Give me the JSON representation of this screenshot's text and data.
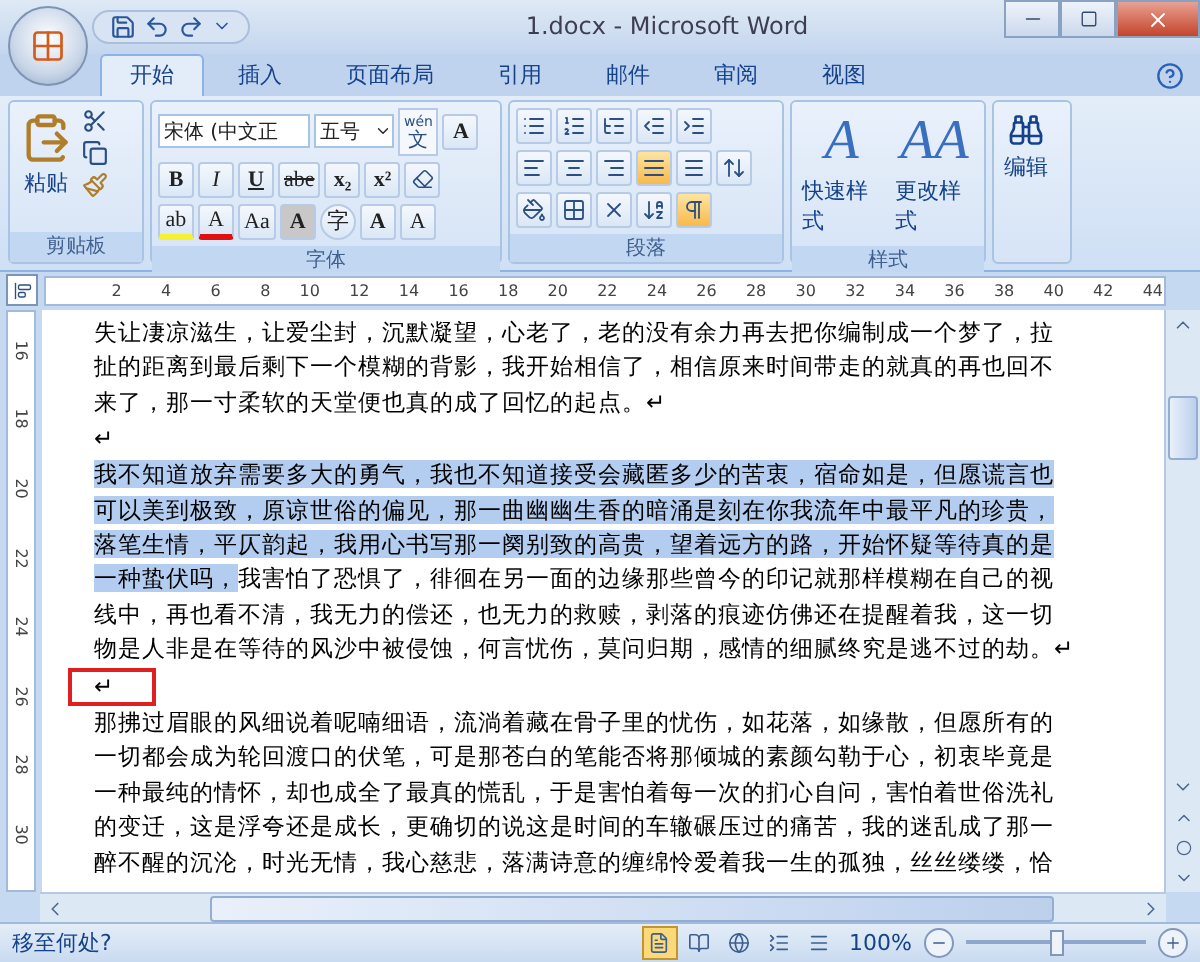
{
  "window": {
    "title": "1.docx - Microsoft Word"
  },
  "tabs": [
    {
      "label": "开始",
      "selected": true
    },
    {
      "label": "插入",
      "selected": false
    },
    {
      "label": "页面布局",
      "selected": false
    },
    {
      "label": "引用",
      "selected": false
    },
    {
      "label": "邮件",
      "selected": false
    },
    {
      "label": "审阅",
      "selected": false
    },
    {
      "label": "视图",
      "selected": false
    }
  ],
  "clipboard": {
    "label": "剪贴板",
    "paste": "粘贴"
  },
  "font": {
    "label": "字体",
    "font_name": "宋体 (中文正",
    "font_size": "五号",
    "phonetic": {
      "pinyin": "wén",
      "char": "文"
    },
    "border_char": "A",
    "row2": [
      {
        "text": "B",
        "kind": "bold"
      },
      {
        "text": "I",
        "kind": "italic"
      },
      {
        "text": "U",
        "kind": "underline"
      },
      {
        "text": "abe",
        "kind": "strike"
      },
      {
        "text": "x₂",
        "kind": "plain"
      },
      {
        "text": "x²",
        "kind": "plain"
      }
    ],
    "row3": [
      {
        "text": "ab",
        "kind": "highlight"
      },
      {
        "text": "A",
        "kind": "color"
      },
      {
        "text": "Aa",
        "kind": "plain"
      },
      {
        "text": "A",
        "kind": "shaded"
      },
      {
        "text": "字",
        "kind": "circled"
      },
      {
        "text": "A",
        "kind": "grow"
      },
      {
        "text": "A",
        "kind": "shrink"
      }
    ]
  },
  "paragraph": {
    "label": "段落",
    "alignment": [
      {
        "selected": false
      },
      {
        "selected": false
      },
      {
        "selected": false
      },
      {
        "selected": true
      },
      {
        "selected": false
      }
    ],
    "show_marks": true
  },
  "styles": {
    "label": "样式",
    "buttons": [
      {
        "glyph": "A",
        "label": "快速样式"
      },
      {
        "glyph": "AA",
        "label": "更改样式"
      }
    ]
  },
  "editing": {
    "label": "编辑"
  },
  "ruler": {
    "ticks": [
      "2",
      "4",
      "6",
      "8",
      "10",
      "12",
      "14",
      "16",
      "18",
      "20",
      "22",
      "24",
      "26",
      "28",
      "30",
      "32",
      "34",
      "36",
      "38",
      "40",
      "42",
      "44"
    ],
    "vertical_ticks": [
      "16",
      "18",
      "20",
      "22",
      "24",
      "26",
      "28",
      "30"
    ]
  },
  "document": {
    "paragraphs": [
      {
        "marked": false,
        "lines": [
          [
            {
              "text": "失让凄凉滋生，让爱尘封，沉默凝望，心老了，老的没有余力再去把你编制成一个梦了，拉",
              "selected": false
            }
          ],
          [
            {
              "text": "扯的距离到最后剩下一个模糊的背影，我开始相信了，相信原来时间带走的就真的再也回不",
              "selected": false
            }
          ],
          [
            {
              "text": "来了，那一寸柔软的天堂便也真的成了回忆的起点。↵",
              "selected": false
            }
          ]
        ]
      },
      {
        "marked": false,
        "lines": [
          [
            {
              "text": "↵",
              "selected": false
            }
          ]
        ]
      },
      {
        "marked": false,
        "lines": [
          [
            {
              "text": "我不知道放弃需要多大的勇气，我也不知道接受会藏匿多少的苦衷，宿命如是，但愿谎言也",
              "selected": true
            }
          ],
          [
            {
              "text": "可以美到极致，原谅世俗的偏见，那一曲幽幽生香的暗涌是刻在你我流年中最平凡的珍贵，",
              "selected": true
            }
          ],
          [
            {
              "text": "落笔生情，平仄韵起，我用心书写那一阕别致的高贵，望着远方的路，开始怀疑等待真的是",
              "selected": true
            }
          ],
          [
            {
              "text": "一种蛰伏吗，",
              "selected": true
            },
            {
              "text": "我害怕了恐惧了，徘徊在另一面的边缘那些曾今的印记就那样模糊在自己的视",
              "selected": false
            }
          ],
          [
            {
              "text": "线中，再也看不清，我无力的偿还，也无力的救赎，剥落的痕迹仿佛还在提醒着我，这一切",
              "selected": false
            }
          ],
          [
            {
              "text": "物是人非是在等待的风沙中被侵蚀，何言忧伤，莫问归期，感情的细腻终究是逃不过的劫。↵",
              "selected": false
            }
          ]
        ]
      },
      {
        "marked": true,
        "lines": [
          [
            {
              "text": "↵",
              "selected": false
            }
          ]
        ]
      },
      {
        "marked": false,
        "lines": [
          [
            {
              "text": "那拂过眉眼的风细说着呢喃细语，流淌着藏在骨子里的忧伤，如花落，如缘散，但愿所有的",
              "selected": false
            }
          ],
          [
            {
              "text": "一切都会成为轮回渡口的伏笔，可是那苍白的笔能否将那倾城的素颜勾勒于心，初衷毕竟是",
              "selected": false
            }
          ],
          [
            {
              "text": "一种最纯的情怀，却也成全了最真的慌乱，于是害怕着每一次的扪心自问，害怕着世俗洗礼",
              "selected": false
            }
          ],
          [
            {
              "text": "的变迁，这是浮夸还是成长，更确切的说这是时间的车辙碾压过的痛苦，我的迷乱成了那一",
              "selected": false
            }
          ],
          [
            {
              "text": "醉不醒的沉沦，时光无情，我心慈悲，落满诗意的缠绵怜爱着我一生的孤独，丝丝缕缕，恰",
              "selected": false
            }
          ]
        ]
      }
    ]
  },
  "status_bar": {
    "message": "移至何处?",
    "view_buttons": [
      {
        "selected": true
      },
      {
        "selected": false
      },
      {
        "selected": false
      },
      {
        "selected": false
      },
      {
        "selected": false
      }
    ],
    "zoom": "100%",
    "zoom_level": {
      "level": 0.5
    }
  }
}
